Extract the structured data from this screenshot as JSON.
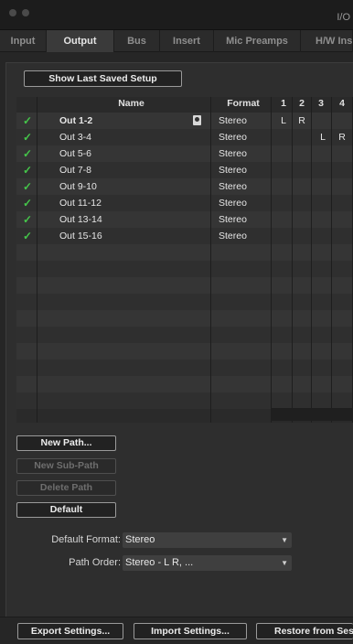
{
  "window": {
    "title": "I/O"
  },
  "tabs": [
    {
      "label": "Input"
    },
    {
      "label": "Output"
    },
    {
      "label": "Bus"
    },
    {
      "label": "Insert"
    },
    {
      "label": "Mic Preamps"
    },
    {
      "label": "H/W Insert"
    }
  ],
  "show_last_saved_label": "Show Last Saved Setup",
  "table": {
    "headers": {
      "name": "Name",
      "format": "Format"
    },
    "channel_headers": [
      "1",
      "2",
      "3",
      "4"
    ],
    "rows": [
      {
        "name": "Out 1-2",
        "format": "Stereo",
        "ch": [
          "L",
          "R",
          "",
          ""
        ]
      },
      {
        "name": "Out 3-4",
        "format": "Stereo",
        "ch": [
          "",
          "",
          "L",
          "R"
        ]
      },
      {
        "name": "Out 5-6",
        "format": "Stereo",
        "ch": [
          "",
          "",
          "",
          ""
        ]
      },
      {
        "name": "Out 7-8",
        "format": "Stereo",
        "ch": [
          "",
          "",
          "",
          ""
        ]
      },
      {
        "name": "Out 9-10",
        "format": "Stereo",
        "ch": [
          "",
          "",
          "",
          ""
        ]
      },
      {
        "name": "Out 11-12",
        "format": "Stereo",
        "ch": [
          "",
          "",
          "",
          ""
        ]
      },
      {
        "name": "Out 13-14",
        "format": "Stereo",
        "ch": [
          "",
          "",
          "",
          ""
        ]
      },
      {
        "name": "Out 15-16",
        "format": "Stereo",
        "ch": [
          "",
          "",
          "",
          ""
        ]
      }
    ]
  },
  "path_buttons": {
    "new_path": "New Path...",
    "new_sub_path": "New Sub-Path",
    "delete_path": "Delete Path",
    "default": "Default"
  },
  "default_format": {
    "label": "Default Format:",
    "value": "Stereo"
  },
  "path_order": {
    "label": "Path Order:",
    "value": "Stereo - L R, ..."
  },
  "footer": {
    "export": "Export Settings...",
    "import": "Import Settings...",
    "restore": "Restore from Session"
  },
  "icons": {
    "checked": "checkmark-icon",
    "locked": "lock-icon",
    "dropdown": "chevron-down-icon"
  },
  "colors": {
    "check": "#45c54a",
    "background": "#262626"
  }
}
